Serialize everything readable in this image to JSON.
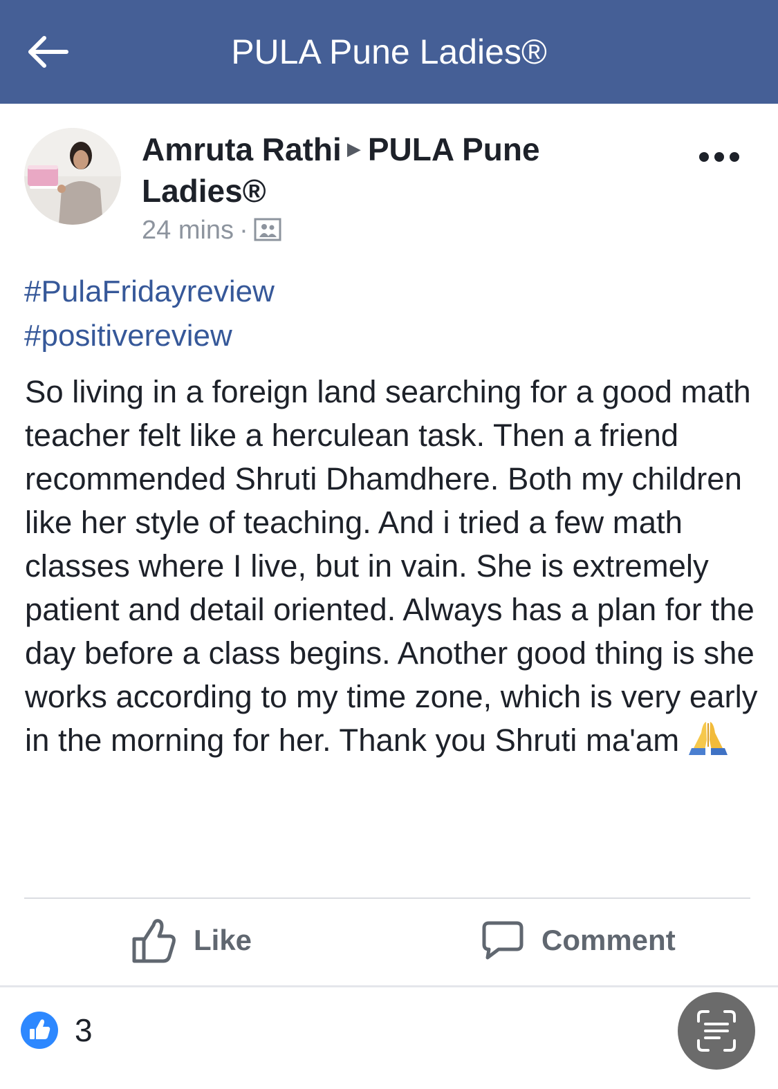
{
  "header": {
    "title": "PULA Pune Ladies®",
    "back_icon": "arrow-left-icon",
    "background": "#455f96"
  },
  "post": {
    "author": "Amruta Rathi",
    "separator_icon": "caret-right-icon",
    "group": "PULA Pune Ladies®",
    "time": "24 mins",
    "meta_separator": "·",
    "audience_icon": "group-audience-icon",
    "more_icon": "more-dots-icon",
    "hashtags": [
      "#PulaFridayreview",
      "#positivereview"
    ],
    "hashtag_color": "#365899",
    "body": "So living in a foreign land searching for a good math teacher felt like a herculean task. Then a friend recommended Shruti Dhamdhere. Both my children like her style of teaching. And i tried a few math classes where I live, but in vain. She is extremely patient and detail oriented. Always has a plan for the day before a class begins. Another good thing is she works according to my time zone, which is very early in the morning for her. Thank you Shruti ma'am",
    "body_emoji_icon": "folded-hands-icon"
  },
  "actions": {
    "like_label": "Like",
    "like_icon": "thumbs-up-outline-icon",
    "comment_label": "Comment",
    "comment_icon": "comment-bubble-icon"
  },
  "reactions": {
    "icon": "like-reaction-icon",
    "count": "3",
    "accent": "#2d88ff"
  },
  "overlay": {
    "scan_icon": "scan-text-icon"
  }
}
